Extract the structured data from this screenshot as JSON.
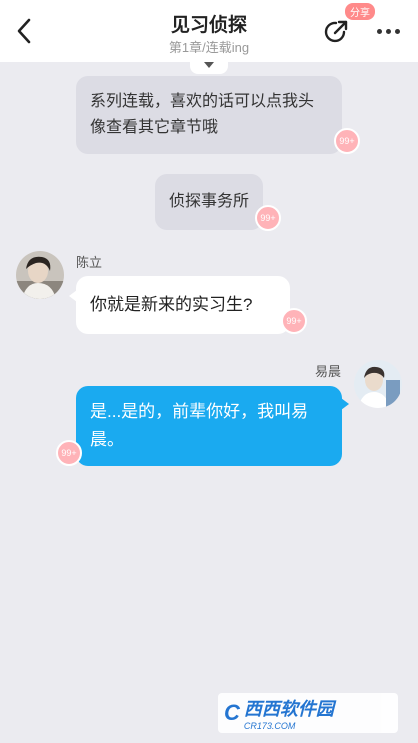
{
  "header": {
    "title": "见习侦探",
    "subtitle": "第1章/连载ing",
    "share_badge": "分享"
  },
  "narrations": [
    {
      "text": "系列连载，喜欢的话可以点我头像查看其它章节哦",
      "likes": "99+"
    },
    {
      "text": "侦探事务所",
      "likes": "99+"
    }
  ],
  "messages": [
    {
      "sender": "陈立",
      "side": "left",
      "text": "你就是新来的实习生?",
      "likes": "99+"
    },
    {
      "sender": "易晨",
      "side": "right",
      "text": "是...是的，前辈你好，我叫易晨。",
      "likes": "99+"
    }
  ],
  "watermark": {
    "logo": "C",
    "main": "西西软件园",
    "sub": "CR173.COM"
  },
  "colors": {
    "accent_blue": "#1aaaf0",
    "badge_pink": "#ffb3b8",
    "background": "#ebebf0"
  }
}
